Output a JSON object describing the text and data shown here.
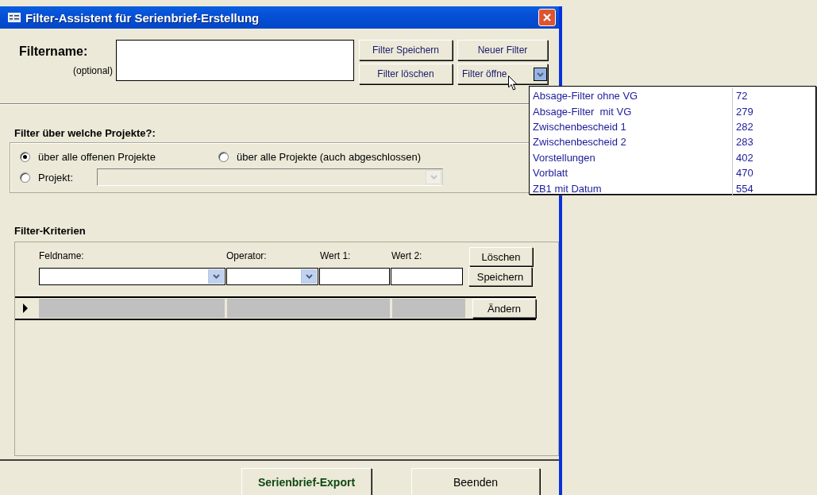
{
  "window": {
    "title": "Filter-Assistent für Serienbrief-Erstellung"
  },
  "filter_name": {
    "label": "Filtername:",
    "hint": "(optional)"
  },
  "top_buttons": [
    "Filter Speichern",
    "Neuer Filter",
    "Filter löschen"
  ],
  "open_filter": {
    "label": "Filter öffne",
    "expanded": true
  },
  "filter_list": [
    {
      "name": "Absage-Filter ohne VG",
      "id": "72"
    },
    {
      "name": "Absage-Filter  mit VG",
      "id": "279"
    },
    {
      "name": "Zwischenbescheid 1",
      "id": "282"
    },
    {
      "name": "Zwischenbescheid 2",
      "id": "283"
    },
    {
      "name": "Vorstellungen",
      "id": "402"
    },
    {
      "name": "Vorblatt",
      "id": "470"
    },
    {
      "name": "ZB1 mit Datum",
      "id": "554"
    }
  ],
  "projects": {
    "title": "Filter über welche Projekte?:",
    "options": [
      {
        "label": "über alle offenen Projekte",
        "selected": true
      },
      {
        "label": "über alle Projekte (auch abgeschlossen)",
        "selected": false
      },
      {
        "label": "Projekt:",
        "selected": false
      }
    ]
  },
  "criteria": {
    "title": "Filter-Kriterien",
    "columns": [
      "Feldname:",
      "Operator:",
      "Wert 1:",
      "Wert 2:"
    ],
    "delete_button": "Löschen",
    "save_button": "Speichern",
    "change_button": "Ändern"
  },
  "footer_buttons": [
    "Serienbrief-Export",
    "Beenden"
  ]
}
